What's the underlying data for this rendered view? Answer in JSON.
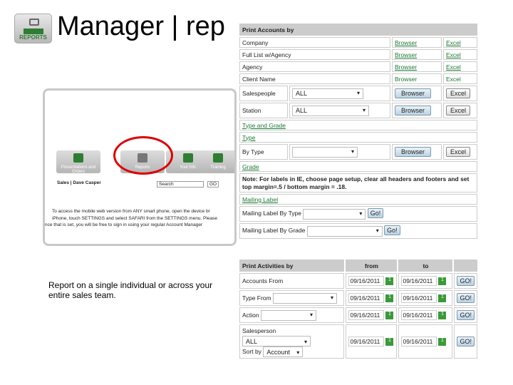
{
  "header": {
    "title": "Manager | rep",
    "logo_label": "REPORTS"
  },
  "left": {
    "tiles": [
      "Presentations and Orders",
      "Reports",
      "Your Info",
      "Training"
    ],
    "user": "Sales | Dave Casper",
    "search_placeholder": "Search",
    "go": "GO",
    "notice": [
      "To access the mobile web version from ANY smart phone, open the device br",
      "iPhone, touch SETTINGS and select SAFARI from the SETTINGS menu. Please",
      "nce that is set, you will be free to sign in using your regular Account Manager"
    ],
    "caption": "Report on a single individual or across your entire sales team."
  },
  "accounts": {
    "header": "Print Accounts by",
    "browser": "Browser",
    "excel": "Excel",
    "link_rows": [
      "Company",
      "Full List w/Agency",
      "Agency",
      "Client Name"
    ],
    "select_rows": [
      {
        "label": "Salespeople",
        "value": "ALL"
      },
      {
        "label": "Station",
        "value": "ALL"
      }
    ],
    "type_and_grade": "Type and Grade",
    "type": "Type",
    "by_type": "By Type",
    "grade": "Grade",
    "note": "Note: For labels in IE, choose page setup, clear all headers and footers and set top margin=.5 / bottom margin = .18.",
    "mailing_label": "Mailing Label",
    "ml_by_type": "Mailing Label By Type",
    "ml_by_grade": "Mailing Label By Grade",
    "go": "Go!"
  },
  "activities": {
    "header": "Print Activities by",
    "from": "from",
    "to": "to",
    "go": "GO!",
    "rows": [
      {
        "label": "Accounts From",
        "from": "09/16/2011",
        "to": "09/16/2011"
      },
      {
        "label": "Type From",
        "from": "09/16/2011",
        "to": "09/16/2011"
      },
      {
        "label": "Action",
        "from": "09/16/2011",
        "to": "09/16/2011"
      },
      {
        "label": "Salesperson",
        "from": "09/16/2011",
        "to": "09/16/2011"
      }
    ],
    "salesperson_value": "ALL",
    "sort_label": "Sort by",
    "sort_value": "Account",
    "cal_icon": "1"
  }
}
